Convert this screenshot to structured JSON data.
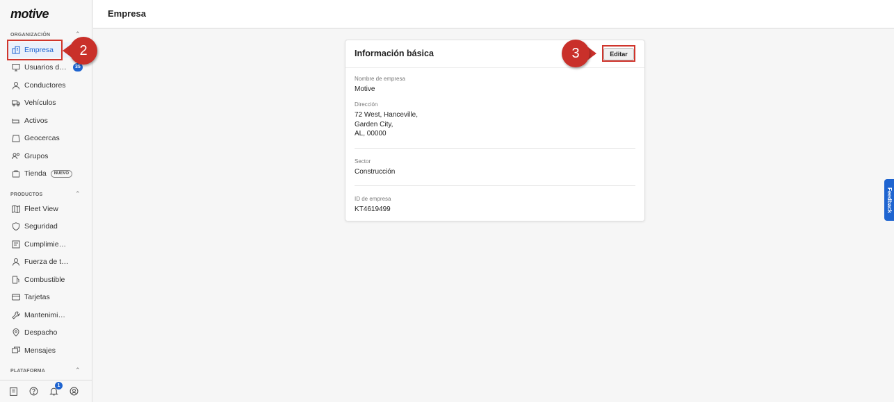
{
  "brand": {
    "logo_text": "motive"
  },
  "header": {
    "title": "Empresa"
  },
  "sidebar": {
    "sections": [
      {
        "label": "ORGANIZACIÓN"
      },
      {
        "label": "PRODUCTOS"
      },
      {
        "label": "PLATAFORMA"
      }
    ],
    "org_items": [
      {
        "label": "Empresa",
        "icon": "building-icon",
        "active": true
      },
      {
        "label": "Usuarios de ...",
        "icon": "monitor-icon",
        "badge": "35"
      },
      {
        "label": "Conductores",
        "icon": "person-icon"
      },
      {
        "label": "Vehículos",
        "icon": "truck-icon"
      },
      {
        "label": "Activos",
        "icon": "trailer-icon"
      },
      {
        "label": "Geocercas",
        "icon": "geofence-icon"
      },
      {
        "label": "Grupos",
        "icon": "group-icon"
      },
      {
        "label": "Tienda",
        "icon": "store-icon",
        "tag": "NUEVO"
      }
    ],
    "product_items": [
      {
        "label": "Fleet View",
        "icon": "map-icon"
      },
      {
        "label": "Seguridad",
        "icon": "shield-icon"
      },
      {
        "label": "Cumplimiento",
        "icon": "compliance-icon"
      },
      {
        "label": "Fuerza de trabajo",
        "icon": "worker-icon"
      },
      {
        "label": "Combustible",
        "icon": "fuel-icon"
      },
      {
        "label": "Tarjetas",
        "icon": "card-icon"
      },
      {
        "label": "Mantenimiento",
        "icon": "wrench-icon"
      },
      {
        "label": "Despacho",
        "icon": "dispatch-icon"
      },
      {
        "label": "Mensajes",
        "icon": "message-icon"
      }
    ],
    "footer": {
      "notification_count": "1"
    }
  },
  "card": {
    "title": "Información básica",
    "edit_label": "Editar",
    "fields": {
      "company_name_label": "Nombre de empresa",
      "company_name": "Motive",
      "address_label": "Dirección",
      "address_line1": "72 West, Hanceville,",
      "address_line2": "Garden City,",
      "address_line3": "AL, 00000",
      "sector_label": "Sector",
      "sector": "Construcción",
      "company_id_label": "ID de empresa",
      "company_id": "KT4619499"
    }
  },
  "callouts": {
    "step2": "2",
    "step3": "3"
  },
  "feedback": {
    "label": "Feedback"
  },
  "colors": {
    "accent": "#1e64d0",
    "callout": "#c9302a",
    "highlight": "#d0352c"
  }
}
